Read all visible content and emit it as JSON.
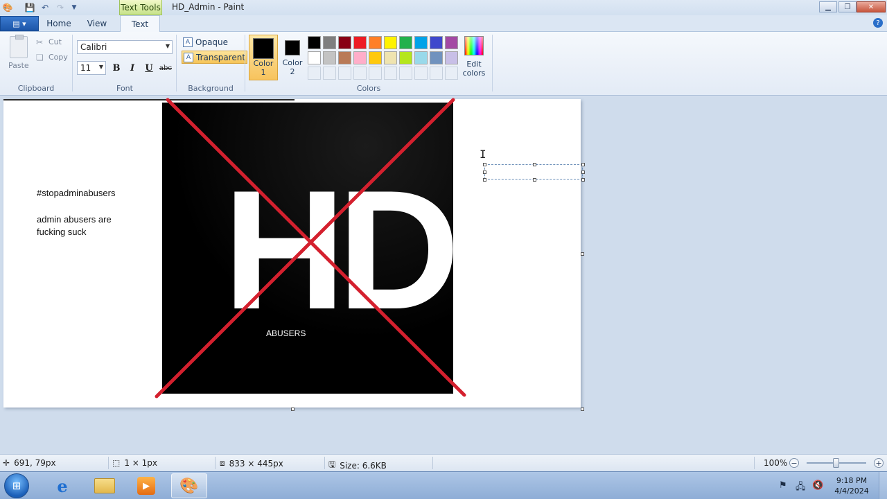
{
  "window": {
    "context_tab": "Text Tools",
    "title": "HD_Admin - Paint",
    "minimize_icon": "minimize-icon",
    "maximize_icon": "restore-icon",
    "close_icon": "close-icon"
  },
  "tabs": [
    {
      "label": "Home"
    },
    {
      "label": "View"
    },
    {
      "label": "Text",
      "active": true
    }
  ],
  "ribbon": {
    "clipboard": {
      "label": "Clipboard",
      "paste": "Paste",
      "cut": "Cut",
      "copy": "Copy"
    },
    "font": {
      "label": "Font",
      "family": "Calibri",
      "size": "11",
      "bold": "B",
      "italic": "I",
      "underline": "U",
      "strike": "abc"
    },
    "background": {
      "label": "Background",
      "opaque": "Opaque",
      "transparent": "Transparent",
      "selected": "Transparent"
    },
    "colors": {
      "label": "Colors",
      "color1": "Color\n1",
      "color1_value": "#000000",
      "color2": "Color\n2",
      "color2_value": "#000000",
      "edit_colors": "Edit\ncolors",
      "palette_row1": [
        "#000000",
        "#7f7f7f",
        "#880015",
        "#ed1c24",
        "#ff7f27",
        "#fff200",
        "#22b14c",
        "#00a2e8",
        "#3f48cc",
        "#a349a4"
      ],
      "palette_row2": [
        "#ffffff",
        "#c3c3c3",
        "#b97a57",
        "#ffaec9",
        "#ffc90e",
        "#efe4b0",
        "#b5e61d",
        "#99d9ea",
        "#7092be",
        "#c8bfe7"
      ]
    }
  },
  "canvas": {
    "text1": "#stopadminabusers",
    "text2_line1": "admin abusers are",
    "text2_line2": "fucking suck",
    "logo_text": "HD",
    "logo_subtext": "ABUSERS",
    "cross_color": "#d4202e"
  },
  "status": {
    "cursor_pos": "691, 79px",
    "selection_size": "1 × 1px",
    "image_size": "833 × 445px",
    "file_size": "Size: 6.6KB",
    "zoom": "100%"
  },
  "taskbar": {
    "time": "9:18 PM",
    "date": "4/4/2024"
  }
}
